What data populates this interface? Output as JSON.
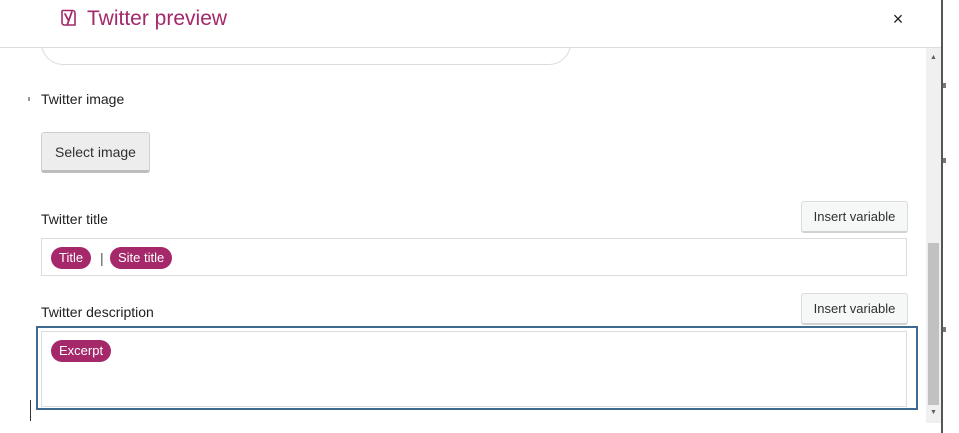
{
  "header": {
    "title": "Twitter preview",
    "close_glyph": "×",
    "logo_icon": "yoast-logo-icon",
    "accent_color": "#a4286a"
  },
  "image_section": {
    "label": "Twitter image",
    "select_button": "Select image"
  },
  "title_section": {
    "label": "Twitter title",
    "insert_variable": "Insert variable",
    "tags": [
      "Title",
      "Site title"
    ],
    "separator": "|"
  },
  "description_section": {
    "label": "Twitter description",
    "insert_variable": "Insert variable",
    "tags": [
      "Excerpt"
    ]
  },
  "scrollbar": {
    "up_glyph": "▲",
    "down_glyph": "▼"
  }
}
